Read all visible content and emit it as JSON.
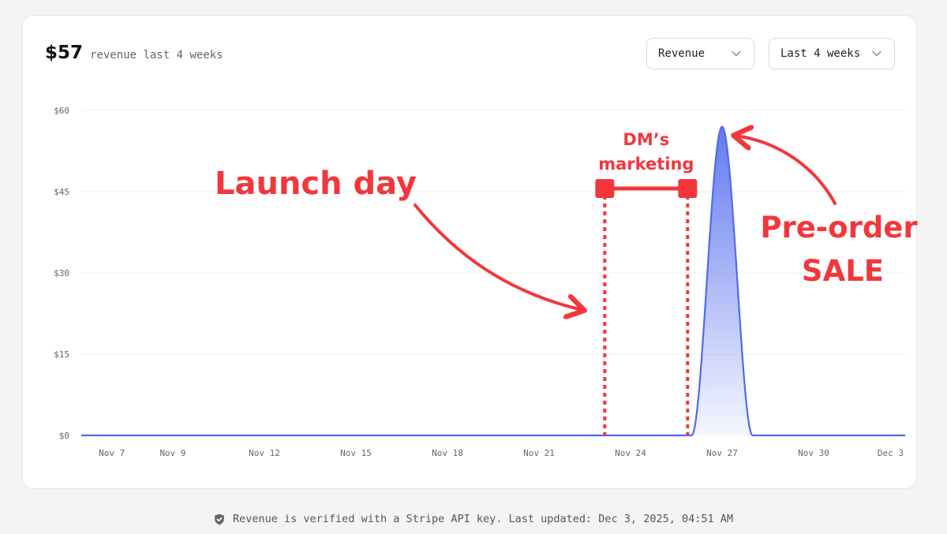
{
  "summary": {
    "value": "$57",
    "label": "revenue last 4 weeks"
  },
  "controls": {
    "metric": {
      "selected": "Revenue",
      "icon": "chevron-down-icon"
    },
    "range": {
      "selected": "Last 4 weeks",
      "icon": "chevron-down-icon"
    }
  },
  "chart_data": {
    "type": "area",
    "y_ticks": [
      "$60",
      "$45",
      "$30",
      "$15",
      "$0"
    ],
    "ylim": [
      0,
      60
    ],
    "x_ticks": [
      "Nov 7",
      "Nov 9",
      "Nov 12",
      "Nov 15",
      "Nov 18",
      "Nov 21",
      "Nov 24",
      "Nov 27",
      "Nov 30",
      "Dec 3"
    ],
    "xlim": [
      "Nov 6",
      "Dec 3"
    ],
    "grid": true,
    "series": [
      {
        "color": "#4f6bed",
        "x": [
          "Nov 6",
          "Nov 7",
          "Nov 8",
          "Nov 9",
          "Nov 10",
          "Nov 11",
          "Nov 12",
          "Nov 13",
          "Nov 14",
          "Nov 15",
          "Nov 16",
          "Nov 17",
          "Nov 18",
          "Nov 19",
          "Nov 20",
          "Nov 21",
          "Nov 22",
          "Nov 23",
          "Nov 24",
          "Nov 25",
          "Nov 26",
          "Nov 27",
          "Nov 28",
          "Nov 29",
          "Nov 30",
          "Dec 1",
          "Dec 2",
          "Dec 3"
        ],
        "values": [
          0,
          0,
          0,
          0,
          0,
          0,
          0,
          0,
          0,
          0,
          0,
          0,
          0,
          0,
          0,
          0,
          0,
          0,
          0,
          0,
          0,
          57,
          0,
          0,
          0,
          0,
          0,
          0
        ]
      }
    ],
    "annotations": {
      "launch": {
        "text": "Launch day",
        "x": "Nov 23"
      },
      "marketing": {
        "line1": "DM’s",
        "line2": "marketing",
        "x_start": "Nov 23",
        "x_end": "Nov 26"
      },
      "preorder": {
        "line1": "Pre-order",
        "line2": "SALE",
        "x": "Nov 27"
      },
      "color": "#f2373c"
    }
  },
  "footer": {
    "icon": "shield-check-icon",
    "text": "Revenue is verified with a Stripe API key. Last updated: Dec 3, 2025, 04:51 AM"
  }
}
